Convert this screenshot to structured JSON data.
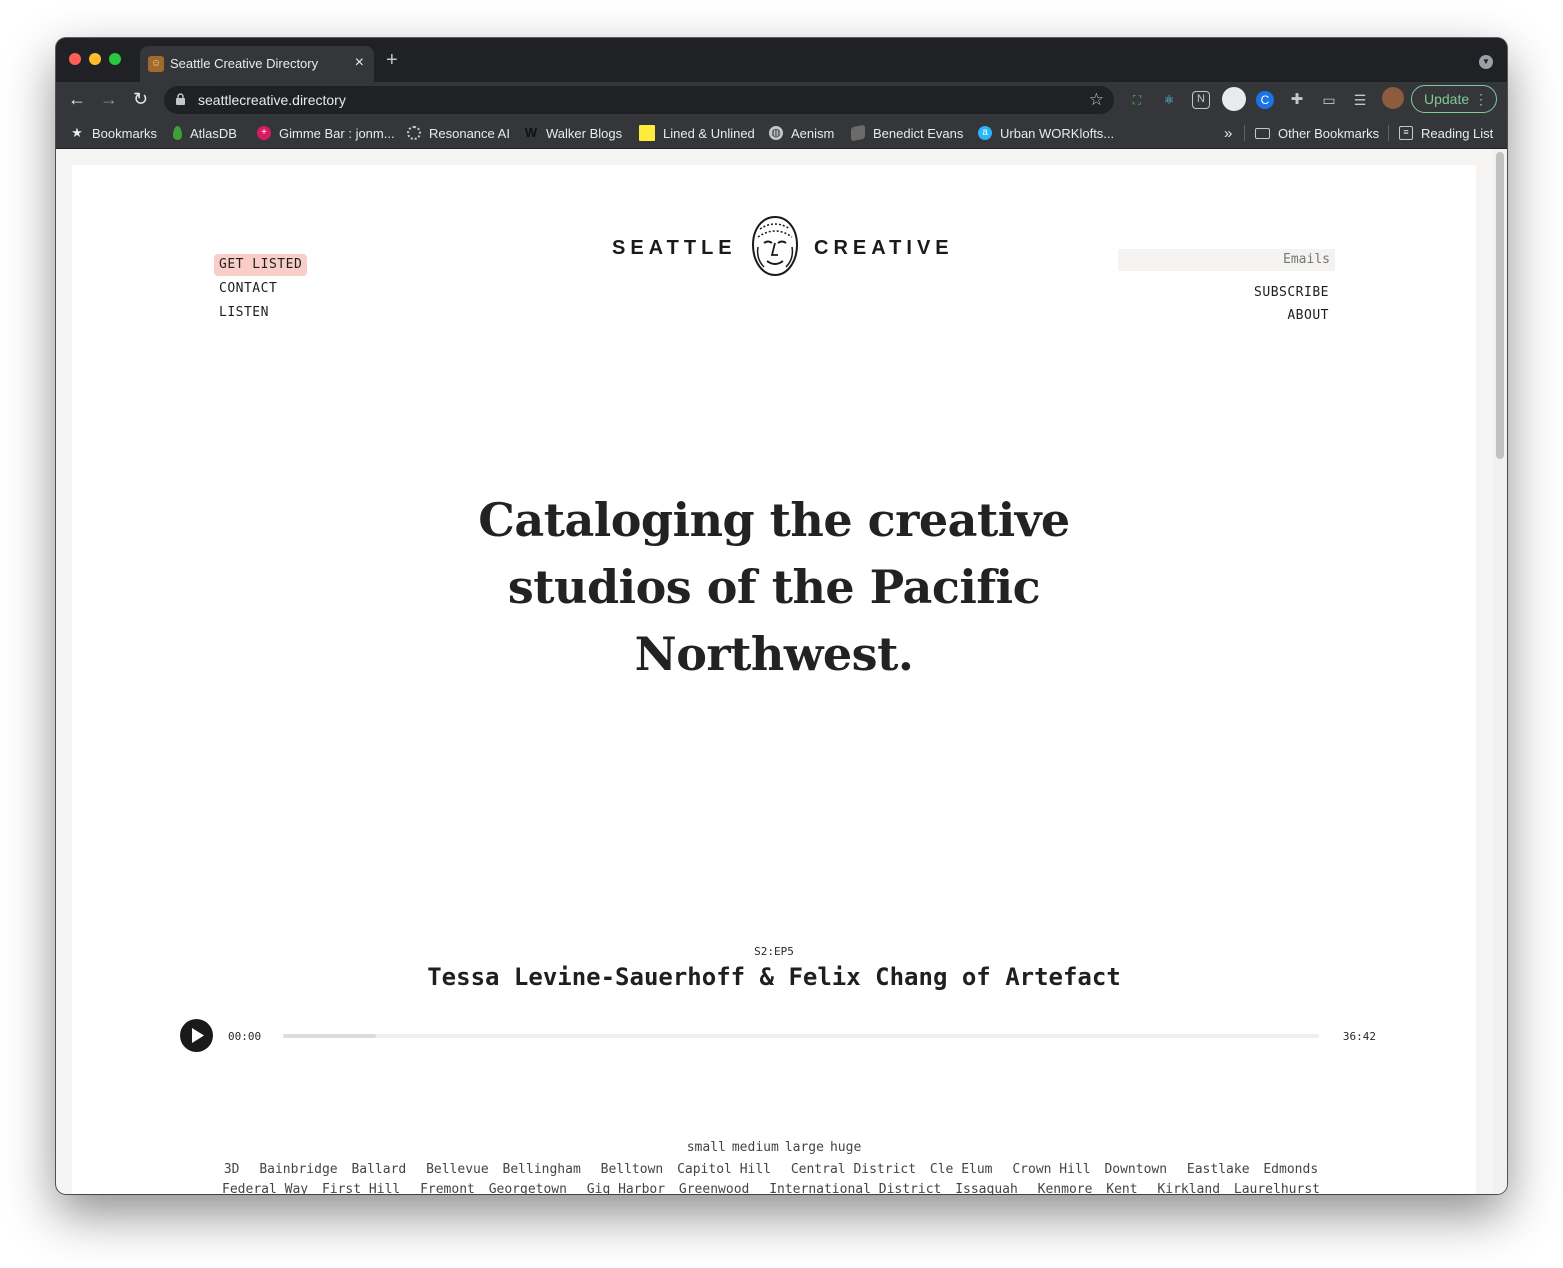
{
  "browser": {
    "tab_title": "Seattle Creative Directory",
    "url": "seattlecreative.directory",
    "update_label": "Update",
    "bookmarks": [
      {
        "label": "Bookmarks",
        "icon": "star-icon"
      },
      {
        "label": "AtlasDB",
        "icon": "leaf-icon"
      },
      {
        "label": "Gimme Bar : jonm...",
        "icon": "gimme-bar-icon"
      },
      {
        "label": "Resonance AI",
        "icon": "resonance-icon"
      },
      {
        "label": "Walker Blogs",
        "icon": "w-icon"
      },
      {
        "label": "Lined & Unlined",
        "icon": "yellow-square-icon"
      },
      {
        "label": "Aenism",
        "icon": "globe-icon"
      },
      {
        "label": "Benedict Evans",
        "icon": "box-icon"
      },
      {
        "label": "Urban WORKlofts...",
        "icon": "urban-icon"
      }
    ],
    "more_bookmarks": "»",
    "other_bookmarks": "Other Bookmarks",
    "reading_list": "Reading List"
  },
  "site": {
    "nav_left": [
      "GET LISTED",
      "CONTACT",
      "LISTEN"
    ],
    "logo_left": "SEATTLE",
    "logo_right": "CREATIVE",
    "emails_placeholder": "Emails",
    "nav_right": [
      "SUBSCRIBE",
      "ABOUT"
    ],
    "hero": "Cataloging the creative studios of the Pacific Northwest.",
    "episode": {
      "number": "S2:EP5",
      "title": "Tessa Levine-Sauerhoff & Felix Chang of Artefact",
      "current_time": "00:00",
      "duration": "36:42",
      "buffered_fraction": 0.09
    },
    "sizes": [
      "small",
      "medium",
      "large",
      "huge"
    ],
    "neighborhoods": [
      "3D",
      "Bainbridge",
      "Ballard",
      "Bellevue",
      "Bellingham",
      "Belltown",
      "Capitol Hill",
      "Central District",
      "Cle Elum",
      "Crown Hill",
      "Downtown",
      "Eastlake",
      "Edmonds",
      "Federal Way",
      "First Hill",
      "Fremont",
      "Georgetown",
      "Gig Harbor",
      "Greenwood",
      "International District",
      "Issaquah",
      "Kenmore",
      "Kent",
      "Kirkland",
      "Laurelhurst"
    ]
  },
  "colors": {
    "get_listed_bg": "#f9cdc8",
    "update_green": "#81c995",
    "chrome_dark": "#202124",
    "chrome_toolbar": "#35363a"
  }
}
